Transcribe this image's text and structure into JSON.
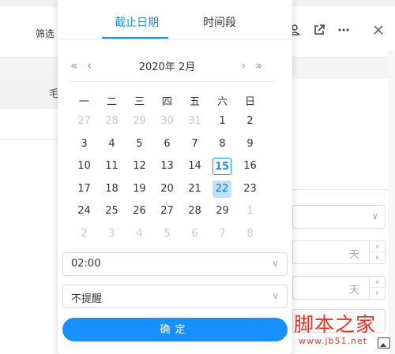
{
  "background": {
    "filter_label": "筛选",
    "partial_row_char": "毛",
    "header_icons": [
      "user-icon",
      "external-link-icon",
      "more-icon",
      "close-icon"
    ],
    "side_fields": [
      {
        "type": "select"
      },
      {
        "type": "number",
        "unit": "天"
      },
      {
        "type": "number",
        "unit": "天"
      },
      {
        "type": "box"
      }
    ]
  },
  "popup": {
    "tabs": [
      {
        "label": "截止日期",
        "active": true
      },
      {
        "label": "时间段",
        "active": false
      }
    ],
    "calendar": {
      "nav_prev_year": "«",
      "nav_prev_month": "‹",
      "nav_next_month": "›",
      "nav_next_year": "»",
      "title": "2020年 2月",
      "weekdays": [
        "一",
        "二",
        "三",
        "四",
        "五",
        "六",
        "日"
      ],
      "weeks": [
        [
          {
            "d": "27",
            "m": 1
          },
          {
            "d": "28",
            "m": 1
          },
          {
            "d": "29",
            "m": 1
          },
          {
            "d": "30",
            "m": 1
          },
          {
            "d": "31",
            "m": 1
          },
          {
            "d": "1"
          },
          {
            "d": "2"
          }
        ],
        [
          {
            "d": "3"
          },
          {
            "d": "4"
          },
          {
            "d": "5"
          },
          {
            "d": "6"
          },
          {
            "d": "7"
          },
          {
            "d": "8"
          },
          {
            "d": "9"
          }
        ],
        [
          {
            "d": "10"
          },
          {
            "d": "11"
          },
          {
            "d": "12"
          },
          {
            "d": "13"
          },
          {
            "d": "14"
          },
          {
            "d": "15",
            "t": 1
          },
          {
            "d": "16"
          }
        ],
        [
          {
            "d": "17"
          },
          {
            "d": "18"
          },
          {
            "d": "19"
          },
          {
            "d": "20"
          },
          {
            "d": "21"
          },
          {
            "d": "22",
            "s": 1
          },
          {
            "d": "23"
          }
        ],
        [
          {
            "d": "24"
          },
          {
            "d": "25"
          },
          {
            "d": "26"
          },
          {
            "d": "27"
          },
          {
            "d": "28"
          },
          {
            "d": "29"
          },
          {
            "d": "1",
            "m": 1
          }
        ],
        [
          {
            "d": "2",
            "m": 1
          },
          {
            "d": "3",
            "m": 1
          },
          {
            "d": "4",
            "m": 1
          },
          {
            "d": "5",
            "m": 1
          },
          {
            "d": "6",
            "m": 1
          },
          {
            "d": "7",
            "m": 1
          },
          {
            "d": "8",
            "m": 1
          }
        ]
      ]
    },
    "time_select": {
      "value": "02:00"
    },
    "reminder_select": {
      "value": "不提醒"
    },
    "confirm_label": "确定"
  },
  "watermark": {
    "text": "脚本之家",
    "url": "www.jb51.net"
  },
  "colors": {
    "accent": "#1890ff",
    "selected_bg": "#bfe1fb",
    "watermark": "#e8332a"
  }
}
